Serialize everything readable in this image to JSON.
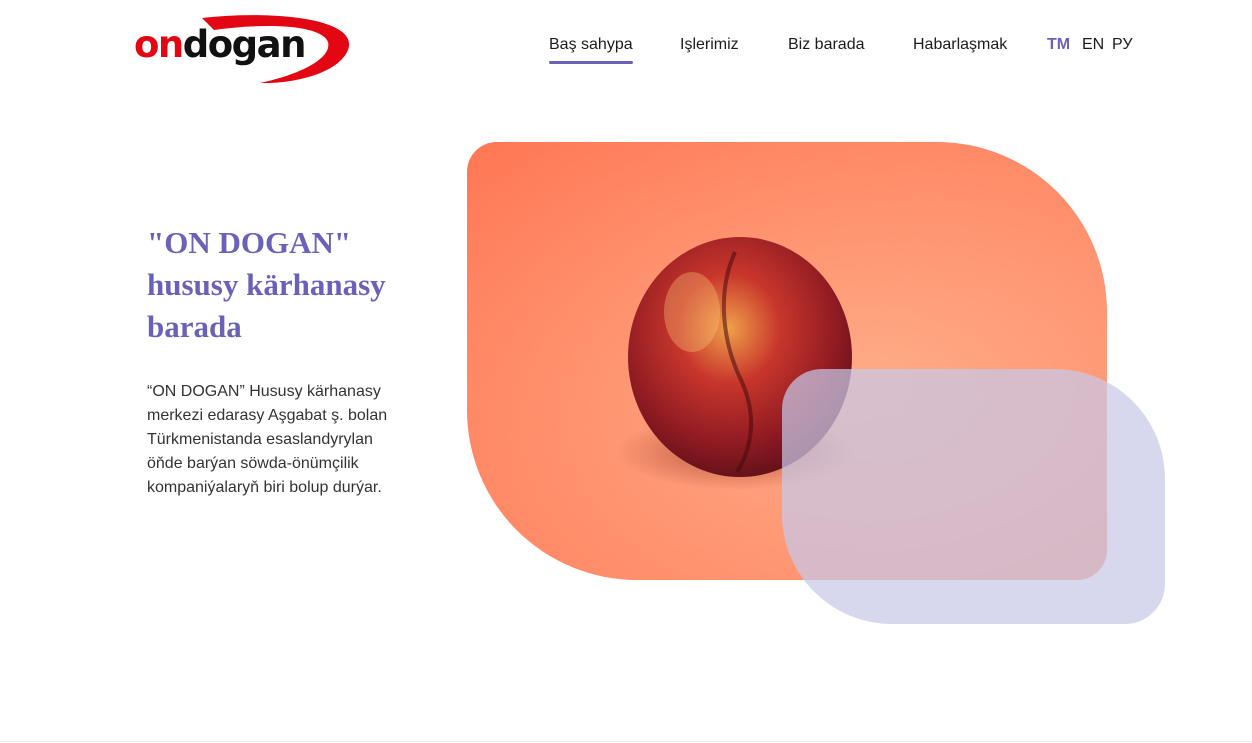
{
  "brand": {
    "logo_on": "on",
    "logo_dogan": "dogan",
    "accent_color": "#6a62b8",
    "logo_red": "#e30613"
  },
  "nav": {
    "items": [
      {
        "label": "Baş sahypa",
        "active": true
      },
      {
        "label": "Işlerimiz",
        "active": false
      },
      {
        "label": "Biz barada",
        "active": false
      },
      {
        "label": "Habarlaşmak",
        "active": false
      }
    ]
  },
  "languages": [
    {
      "label": "TM",
      "active": true
    },
    {
      "label": "EN",
      "active": false
    },
    {
      "label": "РУ",
      "active": false
    }
  ],
  "hero": {
    "title_lines": [
      "\"ON DOGAN\"",
      "hususy kärhanasy",
      "barada"
    ],
    "text_lines": [
      "“ON DOGAN” Hususy kärhanasy",
      "merkezi edarasy Aşgabat ş. bolan",
      "Türkmenistanda esaslandyrylan",
      "öňde barýan söwda-önümçilik",
      "kompaniýalaryň biri bolup durýar."
    ],
    "image": "peach-photo"
  }
}
